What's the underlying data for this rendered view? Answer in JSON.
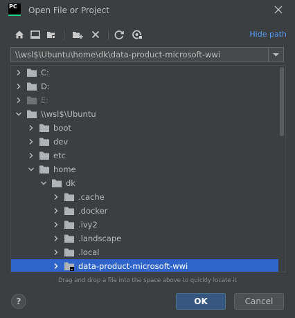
{
  "window": {
    "title": "Open File or Project",
    "logo_text": "PC"
  },
  "toolbar": {
    "buttons": [
      {
        "icon": "home-icon"
      },
      {
        "icon": "desktop-icon"
      },
      {
        "icon": "project-folder-icon"
      },
      {
        "icon": "new-folder-icon"
      },
      {
        "icon": "delete-icon"
      },
      {
        "icon": "refresh-icon"
      },
      {
        "icon": "show-hidden-icon"
      }
    ],
    "hide_path_label": "Hide path"
  },
  "path": {
    "value": "\\\\wsl$\\Ubuntu\\home\\dk\\data-product-microsoft-wwi"
  },
  "tree": {
    "rows": [
      {
        "label": "C:",
        "level": 0,
        "expanded": false,
        "dim": false,
        "selected": false
      },
      {
        "label": "D:",
        "level": 0,
        "expanded": false,
        "dim": false,
        "selected": false
      },
      {
        "label": "E:",
        "level": 0,
        "expanded": false,
        "dim": true,
        "selected": false
      },
      {
        "label": "\\\\wsl$\\Ubuntu",
        "level": 0,
        "expanded": true,
        "dim": false,
        "selected": false
      },
      {
        "label": "boot",
        "level": 1,
        "expanded": false,
        "dim": false,
        "selected": false
      },
      {
        "label": "dev",
        "level": 1,
        "expanded": false,
        "dim": false,
        "selected": false
      },
      {
        "label": "etc",
        "level": 1,
        "expanded": false,
        "dim": false,
        "selected": false
      },
      {
        "label": "home",
        "level": 1,
        "expanded": true,
        "dim": false,
        "selected": false
      },
      {
        "label": "dk",
        "level": 2,
        "expanded": true,
        "dim": false,
        "selected": false
      },
      {
        "label": ".cache",
        "level": 3,
        "expanded": false,
        "dim": false,
        "selected": false
      },
      {
        "label": ".docker",
        "level": 3,
        "expanded": false,
        "dim": false,
        "selected": false
      },
      {
        "label": ".ivy2",
        "level": 3,
        "expanded": false,
        "dim": false,
        "selected": false
      },
      {
        "label": ".landscape",
        "level": 3,
        "expanded": false,
        "dim": false,
        "selected": false
      },
      {
        "label": ".local",
        "level": 3,
        "expanded": false,
        "dim": false,
        "selected": false
      },
      {
        "label": "data-product-microsoft-wwi",
        "level": 3,
        "expanded": false,
        "dim": false,
        "selected": true
      }
    ]
  },
  "hint": "Drag and drop a file into the space above to quickly locate it",
  "buttons": {
    "help_label": "?",
    "ok_label": "OK",
    "cancel_label": "Cancel"
  },
  "colors": {
    "background": "#3c3f41",
    "selection": "#2f65ca",
    "accent_link": "#589df6",
    "primary_button": "#365880"
  }
}
